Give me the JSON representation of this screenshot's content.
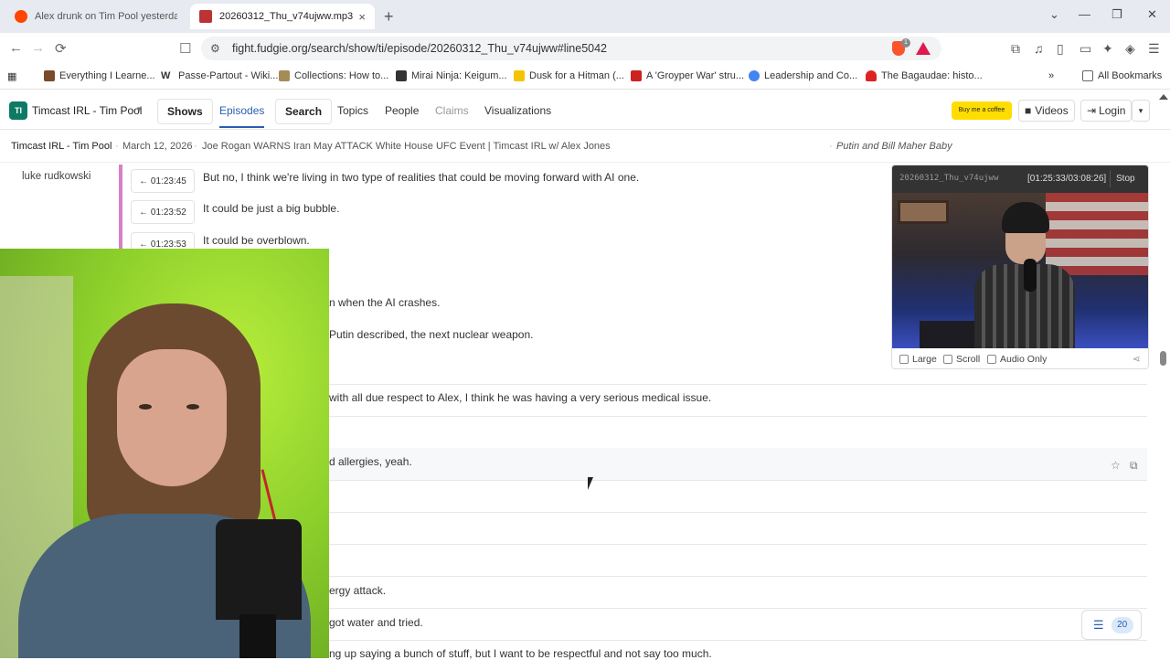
{
  "tabs": [
    {
      "title": "Alex drunk on Tim Pool yesterday : r/",
      "close": "×"
    },
    {
      "title": "20260312_Thu_v74ujww.mp3",
      "close": "×"
    }
  ],
  "new_tab": "+",
  "window_controls": {
    "dropdown": "⌄",
    "minimize": "—",
    "restore": "❐",
    "close": "✕"
  },
  "nav": {
    "back": "←",
    "forward": "→",
    "reload": "⟳",
    "bookmark": "☐"
  },
  "url": "fight.fudgie.org/search/show/ti/episode/20260312_Thu_v74ujww#line5042",
  "shield_count": "1",
  "bookmarks": [
    "Everything I Learne...",
    "Passe-Partout - Wiki...",
    "Collections: How to...",
    "Mirai Ninja: Keigum...",
    "Dusk for a Hitman (...",
    "A 'Groyper War' stru...",
    "Leadership and Co...",
    "The Bagaudae: histo..."
  ],
  "bookmarks_more": "»",
  "all_bookmarks": "All Bookmarks",
  "site": {
    "logo": "TI",
    "show_name": "Timcast IRL - Tim Pool",
    "nav": {
      "shows": "Shows",
      "episodes": "Episodes",
      "search": "Search",
      "topics": "Topics",
      "people": "People",
      "claims": "Claims",
      "visualizations": "Visualizations"
    },
    "coffee": "Buy me a coffee",
    "videos": "Videos",
    "login": "Login"
  },
  "subheader": {
    "show": "Timcast IRL - Tim Pool",
    "sep": "·",
    "date": "March 12, 2026",
    "episode_title": "Joe Rogan WARNS Iran May ATTACK White House UFC Event | Timcast IRL w/ Alex Jones",
    "right_link": "Putin and Bill Maher Baby"
  },
  "transcript": {
    "speaker": "luke rudkowski",
    "timestamp_lines": [
      {
        "time": "← 01:23:45",
        "text": "But no, I think we're living in two type of realities that could be moving forward with AI one."
      },
      {
        "time": "← 01:23:52",
        "text": "It could be just a big bubble."
      },
      {
        "time": "← 01:23:53",
        "text": "It could be overblown."
      }
    ],
    "partial_lines": [
      "n when the AI crashes.",
      "Putin described, the next nuclear weapon.",
      "with all due respect to Alex, I think he was having a very serious medical issue.",
      "d allergies, yeah.",
      "ergy attack.",
      "got water and tried.",
      "ng up saying a bunch of stuff, but I want to be respectful and not say too much."
    ]
  },
  "player": {
    "filename": "20260312_Thu_v74ujww",
    "time": "[01:25:33/03:08:26]",
    "stop": "Stop",
    "options": {
      "large": "Large",
      "scroll": "Scroll",
      "audio_only": "Audio Only"
    }
  },
  "toc_count": "20",
  "colors": {
    "accent": "#2a5db0",
    "logo_bg": "#0e7a65",
    "speaker_bar": "#d77fc8"
  }
}
